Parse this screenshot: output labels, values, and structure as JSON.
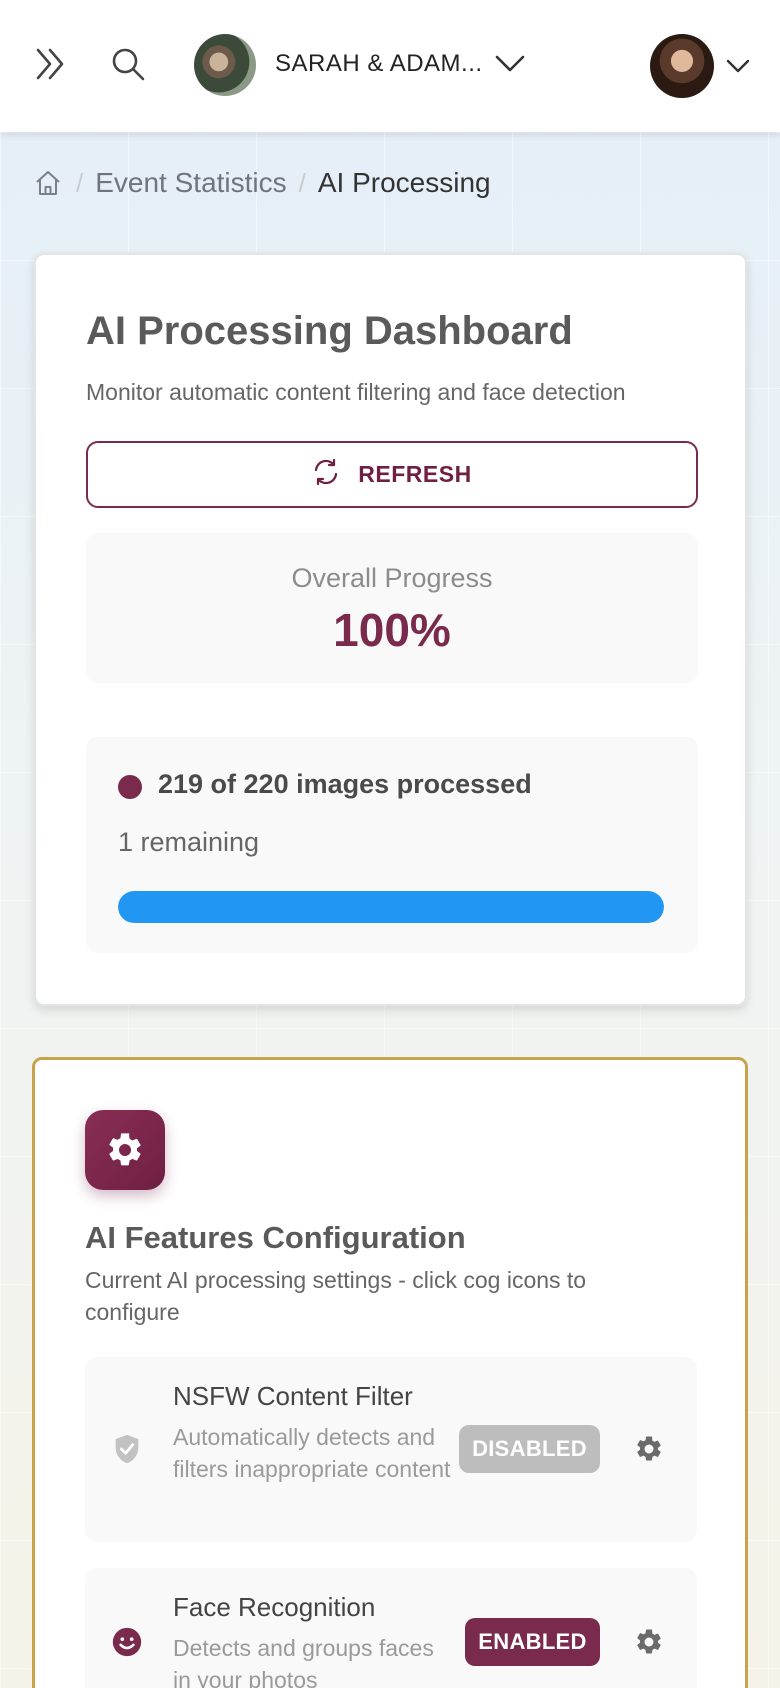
{
  "header": {
    "event_name": "SARAH & ADAM...",
    "menu_icon": "double-chevron-right-icon",
    "search_icon": "search-icon"
  },
  "breadcrumb": {
    "home_icon": "home-icon",
    "items": [
      "Event Statistics",
      "AI Processing"
    ]
  },
  "dashboard": {
    "title": "AI Processing Dashboard",
    "subtitle": "Monitor automatic content filtering and face detection",
    "refresh_label": "REFRESH",
    "overall_progress_label": "Overall Progress",
    "overall_progress_value": "100%",
    "processed_text": "219 of 220 images processed",
    "remaining_text": "1 remaining",
    "progress_fraction": 1.0,
    "colors": {
      "accent": "#7a2a4c",
      "progress_bar": "#2196f3"
    }
  },
  "config": {
    "title": "AI Features Configuration",
    "subtitle": "Current AI processing settings - click cog icons to configure",
    "border_color": "#c9a24c",
    "features": [
      {
        "name": "NSFW Content Filter",
        "description": "Automatically detects and filters inappropriate content",
        "status": "DISABLED",
        "icon": "shield-check-icon"
      },
      {
        "name": "Face Recognition",
        "description": "Detects and groups faces in your photos",
        "status": "ENABLED",
        "icon": "smiley-face-icon"
      }
    ]
  }
}
